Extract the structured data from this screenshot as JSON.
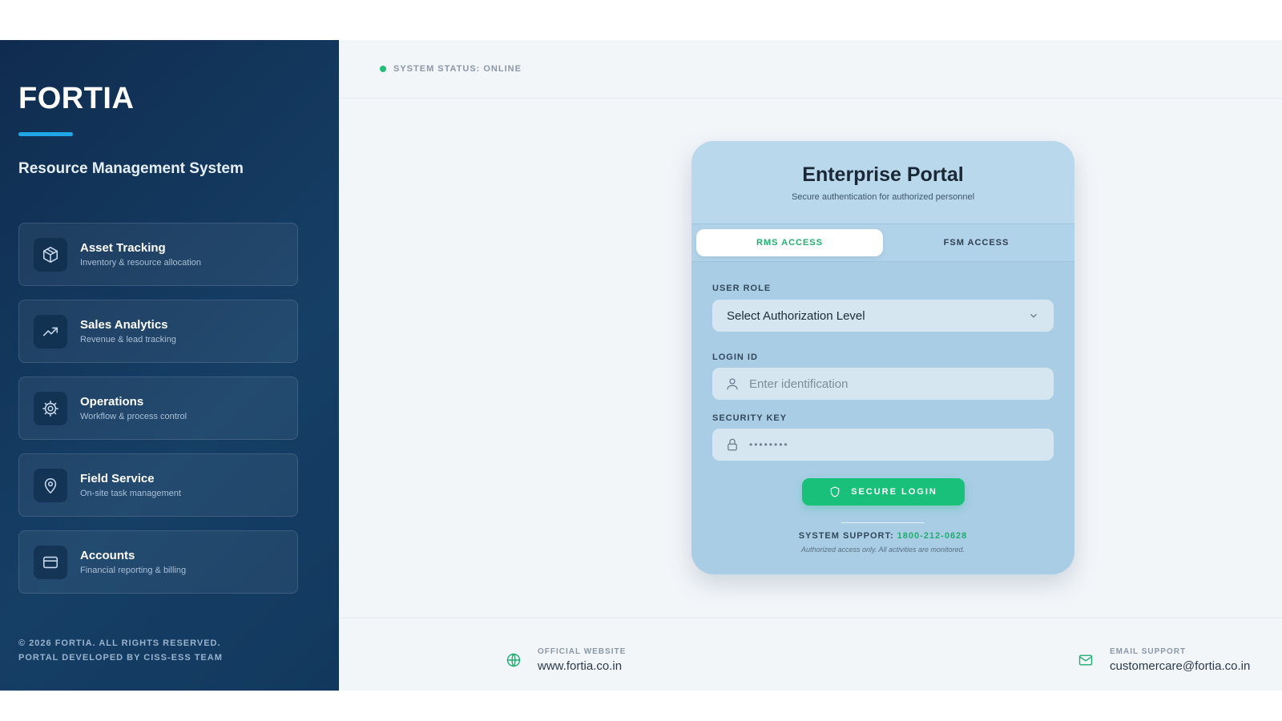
{
  "sidebar": {
    "brand": "FORTIA",
    "subtitle": "Resource Management System",
    "items": [
      {
        "title": "Asset Tracking",
        "desc": "Inventory & resource allocation",
        "icon": "box-icon"
      },
      {
        "title": "Sales Analytics",
        "desc": "Revenue & lead tracking",
        "icon": "trend-up-icon"
      },
      {
        "title": "Operations",
        "desc": "Workflow & process control",
        "icon": "gear-icon"
      },
      {
        "title": "Field Service",
        "desc": "On-site task management",
        "icon": "map-pin-icon"
      },
      {
        "title": "Accounts",
        "desc": "Financial reporting & billing",
        "icon": "credit-card-icon"
      }
    ],
    "copyright_line1": "© 2026 FORTIA. ALL RIGHTS RESERVED.",
    "copyright_line2": "PORTAL DEVELOPED BY CISS-ESS TEAM"
  },
  "topbar": {
    "status": "SYSTEM STATUS: ONLINE",
    "status_color": "#1fbf7a"
  },
  "card": {
    "title": "Enterprise Portal",
    "subtitle": "Secure authentication for authorized personnel",
    "tabs": [
      {
        "label": "RMS ACCESS",
        "active": true
      },
      {
        "label": "FSM ACCESS",
        "active": false
      }
    ],
    "role_label": "USER ROLE",
    "role_value": "Select Authorization Level",
    "login_label": "LOGIN ID",
    "login_placeholder": "Enter identification",
    "key_label": "SECURITY KEY",
    "key_value": "••••••••",
    "button_label": "SECURE LOGIN",
    "support_label": "SYSTEM SUPPORT:",
    "support_phone": "1800-212-0628",
    "note": "Authorized access only. All activities are monitored."
  },
  "footer": {
    "website_label": "OFFICIAL WEBSITE",
    "website_value": "www.fortia.co.in",
    "email_label": "EMAIL SUPPORT",
    "email_value": "customercare@fortia.co.in"
  },
  "colors": {
    "accent": "#19c07a",
    "sidebar_bg": "#0f2c4f",
    "brand_bar": "#1fa7e8"
  }
}
